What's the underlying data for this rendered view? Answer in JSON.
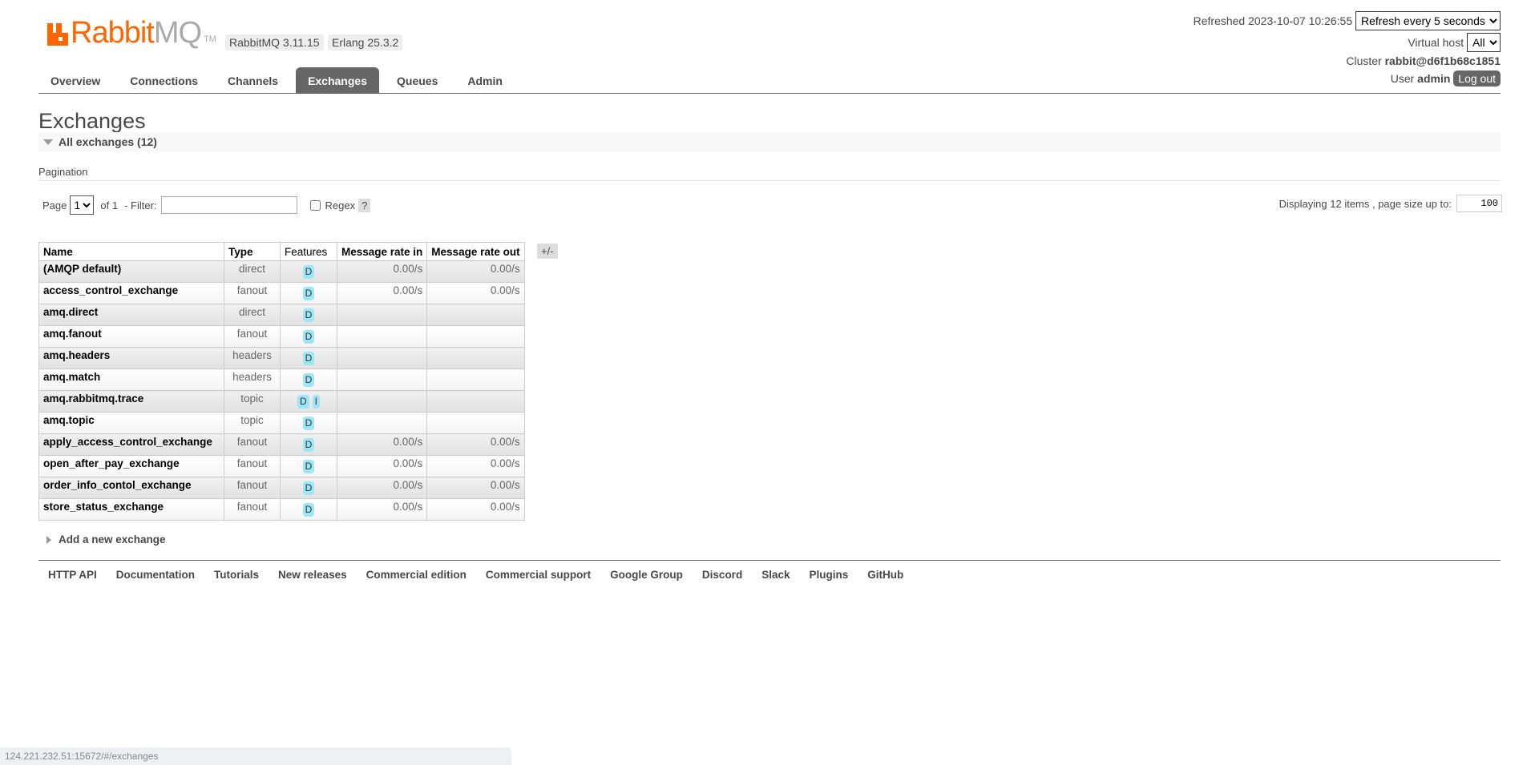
{
  "brand": {
    "logo_text_1": "Rabbit",
    "logo_text_2": "MQ",
    "tm": "TM",
    "color": "#ff6600"
  },
  "versions": {
    "rabbitmq": "RabbitMQ 3.11.15",
    "erlang": "Erlang 25.3.2"
  },
  "nav": {
    "tabs": [
      {
        "label": "Overview"
      },
      {
        "label": "Connections"
      },
      {
        "label": "Channels"
      },
      {
        "label": "Exchanges",
        "selected": true
      },
      {
        "label": "Queues"
      },
      {
        "label": "Admin"
      }
    ]
  },
  "header": {
    "refreshed_label": "Refreshed 2023-10-07 10:26:55",
    "refresh_option": "Refresh every 5 seconds",
    "vhost_label": "Virtual host",
    "vhost_value": "All",
    "cluster_label": "Cluster",
    "cluster_name": "rabbit@d6f1b68c1851",
    "user_label": "User",
    "user_name": "admin",
    "logout_label": "Log out"
  },
  "page": {
    "title": "Exchanges",
    "section": "All exchanges (12)"
  },
  "pagination": {
    "label": "Pagination",
    "page_label": "Page",
    "page_value": "1",
    "of_label": "of 1",
    "filter_label": "- Filter:",
    "filter_value": "",
    "regex_label": "Regex",
    "help": "?",
    "regex_checked": false,
    "display_label": "Displaying 12 items , page size up to:",
    "page_size": "100"
  },
  "table": {
    "columns": [
      "Name",
      "Type",
      "Features",
      "Message rate in",
      "Message rate out"
    ],
    "toggle": "+/-",
    "rows": [
      {
        "name": "(AMQP default)",
        "type": "direct",
        "features": [
          "D"
        ],
        "rate_in": "0.00/s",
        "rate_out": "0.00/s"
      },
      {
        "name": "access_control_exchange",
        "type": "fanout",
        "features": [
          "D"
        ],
        "rate_in": "0.00/s",
        "rate_out": "0.00/s"
      },
      {
        "name": "amq.direct",
        "type": "direct",
        "features": [
          "D"
        ],
        "rate_in": "",
        "rate_out": ""
      },
      {
        "name": "amq.fanout",
        "type": "fanout",
        "features": [
          "D"
        ],
        "rate_in": "",
        "rate_out": ""
      },
      {
        "name": "amq.headers",
        "type": "headers",
        "features": [
          "D"
        ],
        "rate_in": "",
        "rate_out": ""
      },
      {
        "name": "amq.match",
        "type": "headers",
        "features": [
          "D"
        ],
        "rate_in": "",
        "rate_out": ""
      },
      {
        "name": "amq.rabbitmq.trace",
        "type": "topic",
        "features": [
          "D",
          "I"
        ],
        "rate_in": "",
        "rate_out": ""
      },
      {
        "name": "amq.topic",
        "type": "topic",
        "features": [
          "D"
        ],
        "rate_in": "",
        "rate_out": ""
      },
      {
        "name": "apply_access_control_exchange",
        "type": "fanout",
        "features": [
          "D"
        ],
        "rate_in": "0.00/s",
        "rate_out": "0.00/s"
      },
      {
        "name": "open_after_pay_exchange",
        "type": "fanout",
        "features": [
          "D"
        ],
        "rate_in": "0.00/s",
        "rate_out": "0.00/s"
      },
      {
        "name": "order_info_contol_exchange",
        "type": "fanout",
        "features": [
          "D"
        ],
        "rate_in": "0.00/s",
        "rate_out": "0.00/s"
      },
      {
        "name": "store_status_exchange",
        "type": "fanout",
        "features": [
          "D"
        ],
        "rate_in": "0.00/s",
        "rate_out": "0.00/s"
      }
    ]
  },
  "add_exchange": "Add a new exchange",
  "footer": {
    "links": [
      "HTTP API",
      "Documentation",
      "Tutorials",
      "New releases",
      "Commercial edition",
      "Commercial support",
      "Google Group",
      "Discord",
      "Slack",
      "Plugins",
      "GitHub"
    ]
  },
  "status_bar": "124.221.232.51:15672/#/exchanges"
}
